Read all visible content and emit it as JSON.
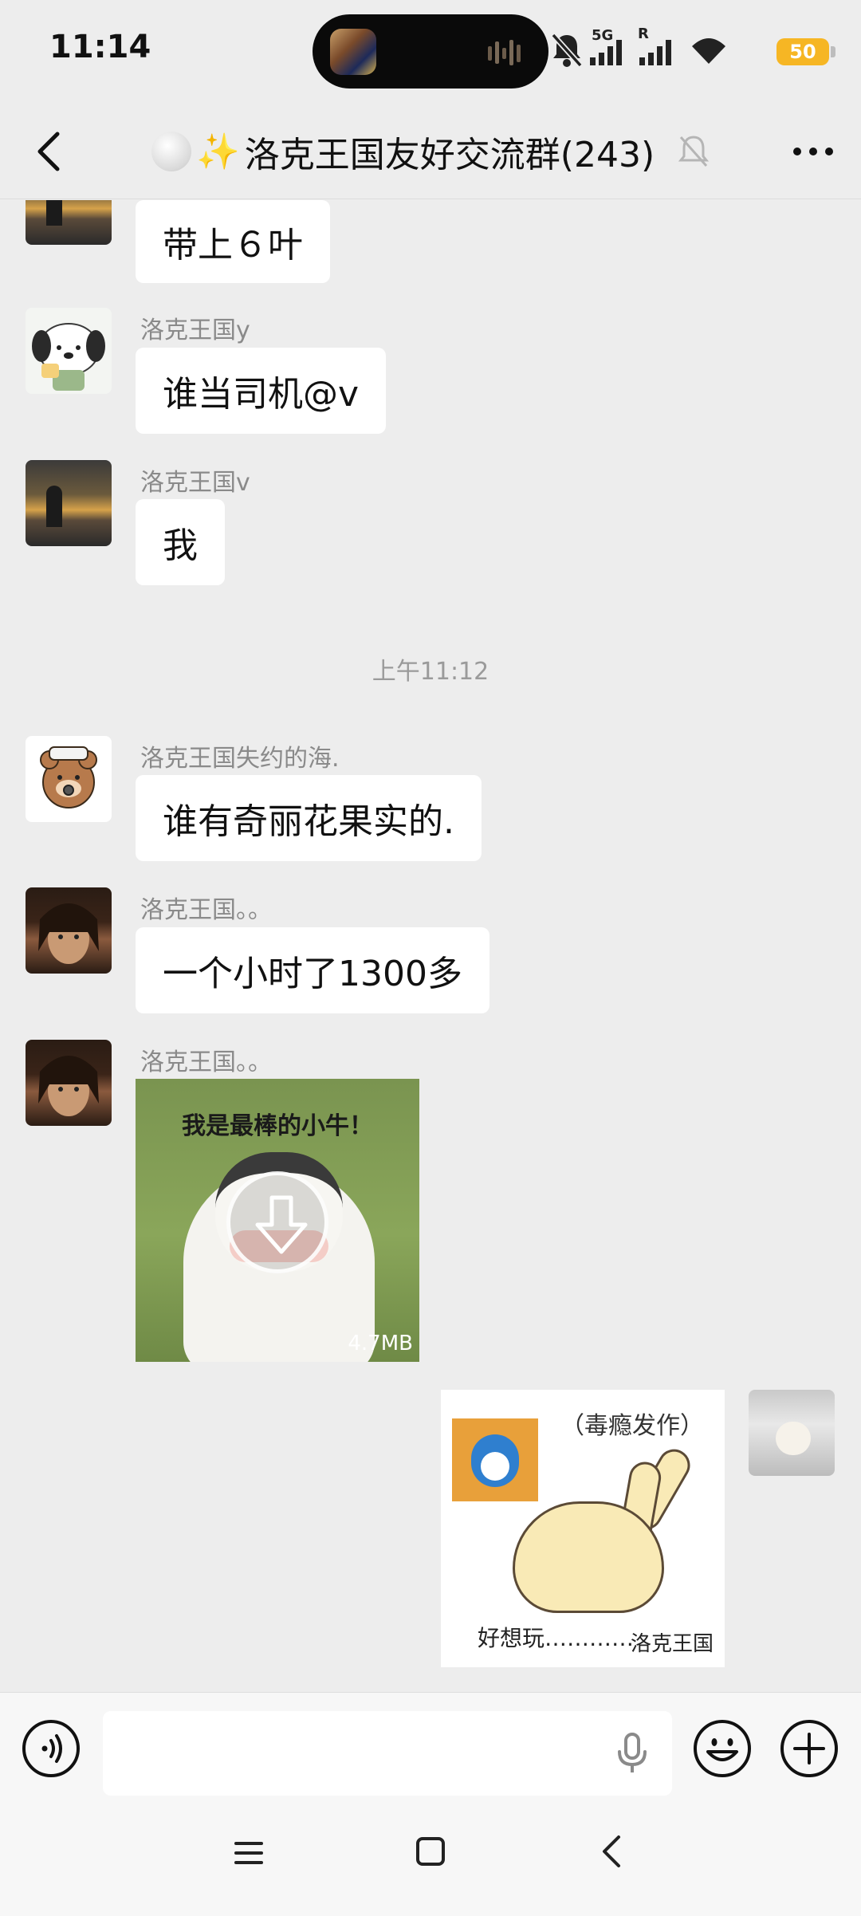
{
  "status_bar": {
    "time": "11:14",
    "network": "5G",
    "roaming_mark": "R",
    "battery": "50",
    "battery_color": "#f6b624"
  },
  "header": {
    "title": "洛克王国友好交流群(243)",
    "title_prefix_icons": [
      "white-circle-icon",
      "sparkles-icon"
    ],
    "muted": true
  },
  "messages": [
    {
      "type": "text",
      "sender": "",
      "text": "带上６叶",
      "avatar": "sunset-avatar"
    },
    {
      "type": "text",
      "sender": "洛克王国y",
      "text": "谁当司机@v",
      "avatar": "puppy-avatar"
    },
    {
      "type": "text",
      "sender": "洛克王国v",
      "text": "我",
      "avatar": "sunset-avatar"
    },
    {
      "type": "time",
      "text": "上午11:12"
    },
    {
      "type": "text",
      "sender": "洛克王国失约的海.",
      "text": "谁有奇丽花果实的.",
      "avatar": "bear-avatar"
    },
    {
      "type": "text",
      "sender": "洛克王国。。",
      "text": "一个小时了1300多",
      "avatar": "guy-avatar"
    },
    {
      "type": "sticker",
      "sender": "洛克王国。。",
      "avatar": "guy-avatar",
      "sticker_text": "我是最棒的小牛！",
      "size": "4.7MB",
      "download_icon": "download-icon"
    },
    {
      "type": "sticker_self",
      "avatar": "cat-avatar",
      "tag": "（毒瘾发作）",
      "caption_left": "好想玩…………",
      "caption_right": "洛克王国"
    }
  ],
  "input_bar": {
    "voice_icon": "voice-mode-icon",
    "mic_icon": "microphone-icon",
    "emoji_icon": "emoji-icon",
    "plus_icon": "plus-icon",
    "value": ""
  },
  "nav_bar": {
    "items": [
      "menu-icon",
      "home-icon",
      "back-icon"
    ]
  },
  "colors": {
    "background": "#ededed",
    "bubble": "#ffffff",
    "sender_text": "#8a8a8a"
  }
}
